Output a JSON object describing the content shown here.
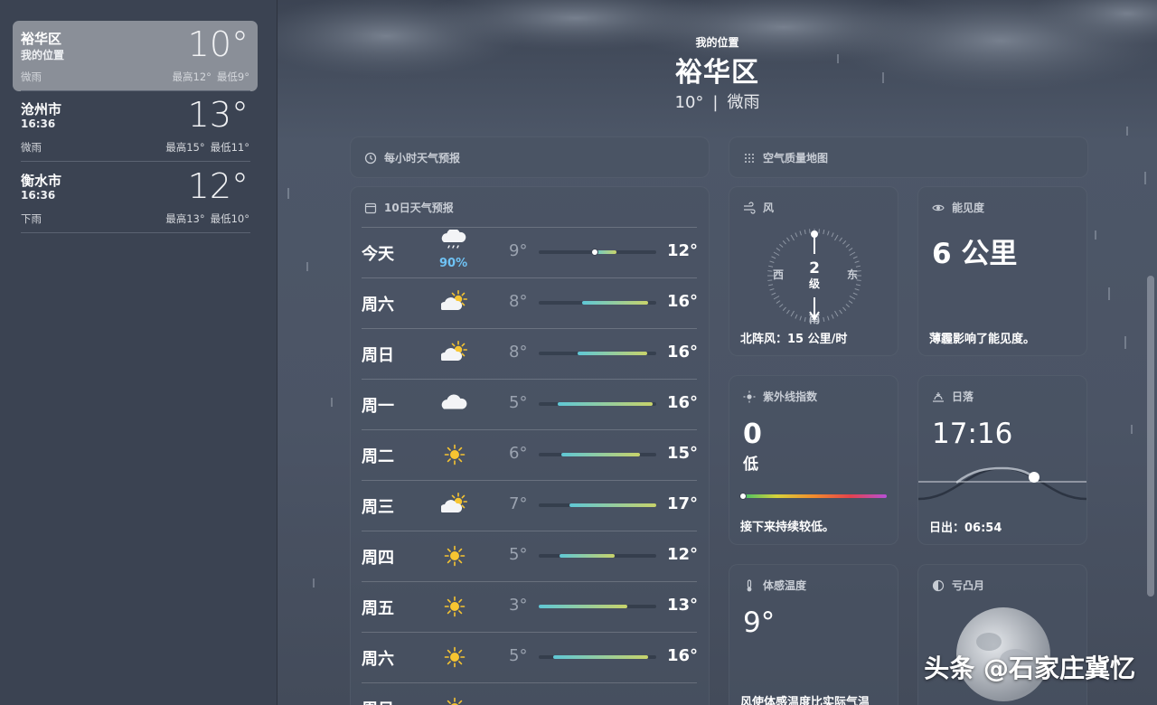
{
  "sidebar": {
    "locations": [
      {
        "name": "裕华区",
        "subtitle": "我的位置",
        "temp": "10°",
        "condition": "微雨",
        "high": "最高12°",
        "low": "最低9°"
      },
      {
        "name": "沧州市",
        "subtitle": "16:36",
        "temp": "13°",
        "condition": "微雨",
        "high": "最高15°",
        "low": "最低11°"
      },
      {
        "name": "衡水市",
        "subtitle": "16:36",
        "temp": "12°",
        "condition": "下雨",
        "high": "最高13°",
        "low": "最低10°"
      }
    ]
  },
  "header": {
    "subtitle": "我的位置",
    "city": "裕华区",
    "temp": "10°",
    "separator": "|",
    "condition": "微雨"
  },
  "cards": {
    "hourly_title": "每小时天气预报",
    "aqi_map_title": "空气质量地图",
    "ten_day_title": "10日天气预报",
    "wind": {
      "title": "风",
      "level": "2",
      "unit": "级",
      "west": "西",
      "east": "东",
      "south": "南",
      "north_marker": "N",
      "footer": "北阵风：15 公里/时"
    },
    "visibility": {
      "title": "能见度",
      "value": "6 公里",
      "footer": "薄霾影响了能见度。"
    },
    "uv": {
      "title": "紫外线指数",
      "value": "0",
      "label": "低",
      "footer": "接下来持续较低。"
    },
    "sunset": {
      "title": "日落",
      "time": "17:16",
      "footer": "日出：06:54"
    },
    "feels_like": {
      "title": "体感温度",
      "value": "9°",
      "footer": "风使体感温度比实际气温"
    },
    "moon": {
      "title": "亏凸月"
    }
  },
  "forecast": [
    {
      "day": "今天",
      "icon": "rain-cloud-icon",
      "pct": "90%",
      "low": "9°",
      "high": "12°",
      "range_start": 0.46,
      "range_end": 0.66,
      "dot": 0.48
    },
    {
      "day": "周六",
      "icon": "partly-sunny-icon",
      "pct": "",
      "low": "8°",
      "high": "16°",
      "range_start": 0.37,
      "range_end": 0.93
    },
    {
      "day": "周日",
      "icon": "partly-sunny-icon",
      "pct": "",
      "low": "8°",
      "high": "16°",
      "range_start": 0.33,
      "range_end": 0.92
    },
    {
      "day": "周一",
      "icon": "cloud-icon",
      "pct": "",
      "low": "5°",
      "high": "16°",
      "range_start": 0.16,
      "range_end": 0.97
    },
    {
      "day": "周二",
      "icon": "sun-icon",
      "pct": "",
      "low": "6°",
      "high": "15°",
      "range_start": 0.19,
      "range_end": 0.86
    },
    {
      "day": "周三",
      "icon": "partly-sunny-icon",
      "pct": "",
      "low": "7°",
      "high": "17°",
      "range_start": 0.26,
      "range_end": 1.0
    },
    {
      "day": "周四",
      "icon": "sun-icon",
      "pct": "",
      "low": "5°",
      "high": "12°",
      "range_start": 0.18,
      "range_end": 0.65
    },
    {
      "day": "周五",
      "icon": "sun-icon",
      "pct": "",
      "low": "3°",
      "high": "13°",
      "range_start": 0.0,
      "range_end": 0.75
    },
    {
      "day": "周六",
      "icon": "sun-icon",
      "pct": "",
      "low": "5°",
      "high": "16°",
      "range_start": 0.12,
      "range_end": 0.93
    },
    {
      "day": "周日",
      "icon": "sun-icon",
      "pct": "",
      "low": "",
      "high": "",
      "range_start": 0.0,
      "range_end": 0.0
    }
  ],
  "colors": {
    "range_cool": "#5fc7d6",
    "range_warm": "#c8d36a",
    "sun": "#f7c531",
    "rain_pct": "#6fc3f5"
  },
  "watermark": "头条 @石家庄冀忆"
}
